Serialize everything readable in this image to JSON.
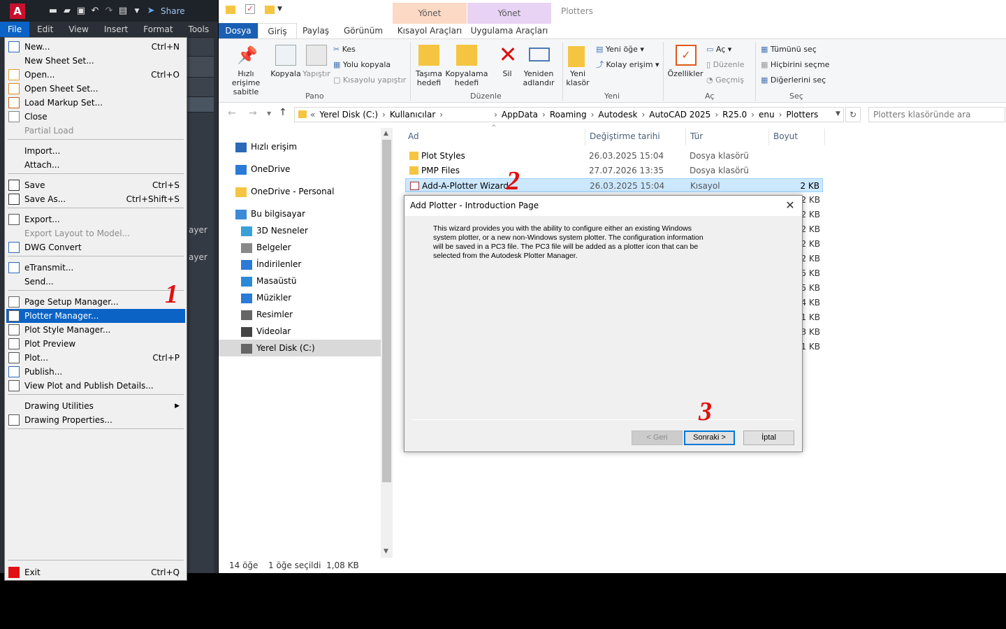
{
  "autocad": {
    "share_label": "Share",
    "menubar": [
      "File",
      "Edit",
      "View",
      "Insert",
      "Format",
      "Tools"
    ],
    "side_labels": [
      "ayer",
      "ayer"
    ],
    "file_menu": [
      {
        "label": "New...",
        "shortcut": "Ctrl+N",
        "icon": "new-icon"
      },
      {
        "label": "New Sheet Set...",
        "shortcut": "",
        "icon": ""
      },
      {
        "label": "Open...",
        "shortcut": "Ctrl+O",
        "icon": "open-icon"
      },
      {
        "label": "Open Sheet Set...",
        "shortcut": "",
        "icon": "sheet-set-icon"
      },
      {
        "label": "Load Markup Set...",
        "shortcut": "",
        "icon": "markup-icon"
      },
      {
        "label": "Close",
        "shortcut": "",
        "icon": "close-doc-icon"
      },
      {
        "label": "Partial Load",
        "shortcut": "",
        "icon": "",
        "disabled": true
      },
      {
        "label": "Import...",
        "shortcut": "",
        "icon": ""
      },
      {
        "label": "Attach...",
        "shortcut": "",
        "icon": ""
      },
      {
        "label": "Save",
        "shortcut": "Ctrl+S",
        "icon": "save-icon"
      },
      {
        "label": "Save As...",
        "shortcut": "Ctrl+Shift+S",
        "icon": "save-as-icon"
      },
      {
        "label": "Export...",
        "shortcut": "",
        "icon": "export-icon"
      },
      {
        "label": "Export Layout to Model...",
        "shortcut": "",
        "icon": "",
        "disabled": true
      },
      {
        "label": "DWG Convert",
        "shortcut": "",
        "icon": "dwg-convert-icon"
      },
      {
        "label": "eTransmit...",
        "shortcut": "",
        "icon": "etransmit-icon"
      },
      {
        "label": "Send...",
        "shortcut": "",
        "icon": ""
      },
      {
        "label": "Page Setup Manager...",
        "shortcut": "",
        "icon": "page-setup-icon"
      },
      {
        "label": "Plotter Manager...",
        "shortcut": "",
        "icon": "plotter-icon",
        "highlighted": true
      },
      {
        "label": "Plot Style Manager...",
        "shortcut": "",
        "icon": "plot-style-icon"
      },
      {
        "label": "Plot Preview",
        "shortcut": "",
        "icon": "plot-preview-icon"
      },
      {
        "label": "Plot...",
        "shortcut": "Ctrl+P",
        "icon": "plot-icon"
      },
      {
        "label": "Publish...",
        "shortcut": "",
        "icon": "publish-icon"
      },
      {
        "label": "View Plot and Publish Details...",
        "shortcut": "",
        "icon": "plot-details-icon"
      },
      {
        "label": "Drawing Utilities",
        "shortcut": "",
        "icon": "",
        "submenu": true
      },
      {
        "label": "Drawing Properties...",
        "shortcut": "",
        "icon": "properties-icon"
      },
      {
        "label": "Exit",
        "shortcut": "Ctrl+Q",
        "icon": "exit-icon"
      }
    ]
  },
  "explorer": {
    "title": "Plotters",
    "tabs": {
      "dosya": "Dosya",
      "giris": "Giriş",
      "paylas": "Paylaş",
      "gorunum": "Görünüm",
      "kisayol": "Kısayol Araçları",
      "uygulama": "Uygulama Araçları",
      "ctx1": "Yönet",
      "ctx2": "Yönet"
    },
    "ribbon": {
      "pin": "Hızlı erişime sabitle",
      "copy": "Kopyala",
      "paste": "Yapıştır",
      "cut": "Kes",
      "copy_path": "Yolu kopyala",
      "paste_shortcut": "Kısayolu yapıştır",
      "group_pano": "Pano",
      "move_to": "Taşıma hedefi",
      "copy_to": "Kopyalama hedefi",
      "delete": "Sil",
      "rename": "Yeniden adlandır",
      "group_duzenle": "Düzenle",
      "new_folder": "Yeni klasör",
      "new_item": "Yeni öğe",
      "easy_access": "Kolay erişim",
      "group_yeni": "Yeni",
      "properties": "Özellikler",
      "open": "Aç",
      "edit": "Düzenle",
      "history": "Geçmiş",
      "group_ac": "Aç",
      "select_all": "Tümünü seç",
      "select_none": "Hiçbirini seçme",
      "invert": "Diğerlerini seç",
      "group_sec": "Seç"
    },
    "address": [
      "«",
      "Yerel Disk (C:)",
      "›",
      "Kullanıcılar",
      "›",
      "",
      "›",
      "AppData",
      "›",
      "Roaming",
      "›",
      "Autodesk",
      "›",
      "AutoCAD 2025",
      "›",
      "R25.0",
      "›",
      "enu",
      "›",
      "Plotters"
    ],
    "search_placeholder": "Plotters klasöründe ara",
    "nav": [
      {
        "label": "Hızlı erişim",
        "icon": "star-icon"
      },
      {
        "label": "OneDrive",
        "icon": "cloud-icon"
      },
      {
        "label": "OneDrive - Personal",
        "icon": "folder-icon"
      },
      {
        "label": "Bu bilgisayar",
        "icon": "computer-icon"
      },
      {
        "label": "3D Nesneler",
        "icon": "cube-icon"
      },
      {
        "label": "Belgeler",
        "icon": "documents-icon"
      },
      {
        "label": "İndirilenler",
        "icon": "download-icon"
      },
      {
        "label": "Masaüstü",
        "icon": "desktop-icon"
      },
      {
        "label": "Müzikler",
        "icon": "music-icon"
      },
      {
        "label": "Resimler",
        "icon": "pictures-icon"
      },
      {
        "label": "Videolar",
        "icon": "video-icon"
      },
      {
        "label": "Yerel Disk (C:)",
        "icon": "drive-icon"
      }
    ],
    "columns": {
      "name": "Ad",
      "modified": "Değiştirme tarihi",
      "type": "Tür",
      "size": "Boyut"
    },
    "files": [
      {
        "name": "Plot Styles",
        "modified": "26.03.2025 15:04",
        "type": "Dosya klasörü",
        "size": ""
      },
      {
        "name": "PMP Files",
        "modified": "27.07.2026 13:35",
        "type": "Dosya klasörü",
        "size": ""
      },
      {
        "name": "Add-A-Plotter Wizard",
        "modified": "26.03.2025 15:04",
        "type": "Kısayol",
        "size": "2 KB"
      }
    ],
    "hidden_sizes": [
      "2 KB",
      "2 KB",
      "2 KB",
      "2 KB",
      "2 KB",
      "5 KB",
      "5 KB",
      "4 KB",
      "1 KB",
      "3 KB",
      "1 KB"
    ],
    "status": {
      "count": "14 öğe",
      "selected": "1 öğe seçildi  1,08 KB"
    }
  },
  "dialog": {
    "title": "Add Plotter - Introduction Page",
    "body": "This wizard provides you with the ability to configure either an existing Windows system plotter, or a new non-Windows system plotter. The configuration information will be saved in a PC3 file. The PC3 file will be added as a plotter icon that can be selected from the Autodesk Plotter Manager.",
    "back": "< Geri",
    "next": "Sonraki >",
    "cancel": "İptal"
  },
  "annotations": [
    "1",
    "2",
    "3"
  ],
  "colors": {
    "accent": "#0b63c6",
    "annotation": "#e01010",
    "explorer_tab": "#1a5fb4"
  }
}
